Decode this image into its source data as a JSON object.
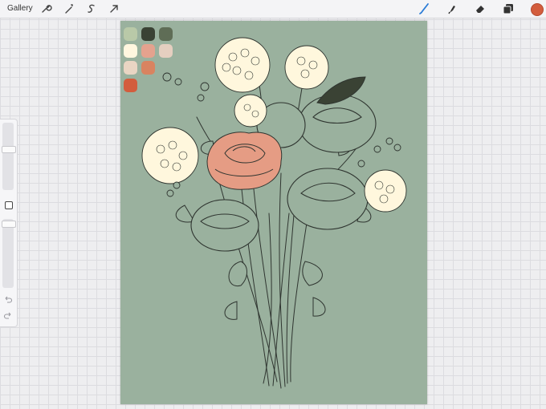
{
  "toolbar": {
    "gallery_label": "Gallery",
    "left_icons": [
      "wrench-icon",
      "magic-wand-icon",
      "selection-icon",
      "transform-arrow-icon"
    ],
    "right_icons": [
      "brush-icon",
      "smudge-icon",
      "eraser-icon",
      "layers-icon"
    ],
    "current_color": "#d35d3d"
  },
  "sidebar": {
    "brush_size_level": 0.25,
    "opacity_level": 0.05,
    "icons": [
      "modify-square-icon",
      "undo-icon",
      "redo-icon"
    ]
  },
  "canvas": {
    "background_color": "#9ab19e",
    "palette_colors": [
      "#b9c9a8",
      "#3a4234",
      "#5f6d56",
      "#fff6df",
      "#e4a28e",
      "#e5cfc0",
      "#e9d5c3",
      "#d98360",
      "#d35d3d"
    ],
    "artwork_colors": {
      "line": "#2f3530",
      "hydrangea_fill": "#fff7dd",
      "rose_fill": "#e59c84",
      "leaf_fill": "#3a4234"
    }
  }
}
